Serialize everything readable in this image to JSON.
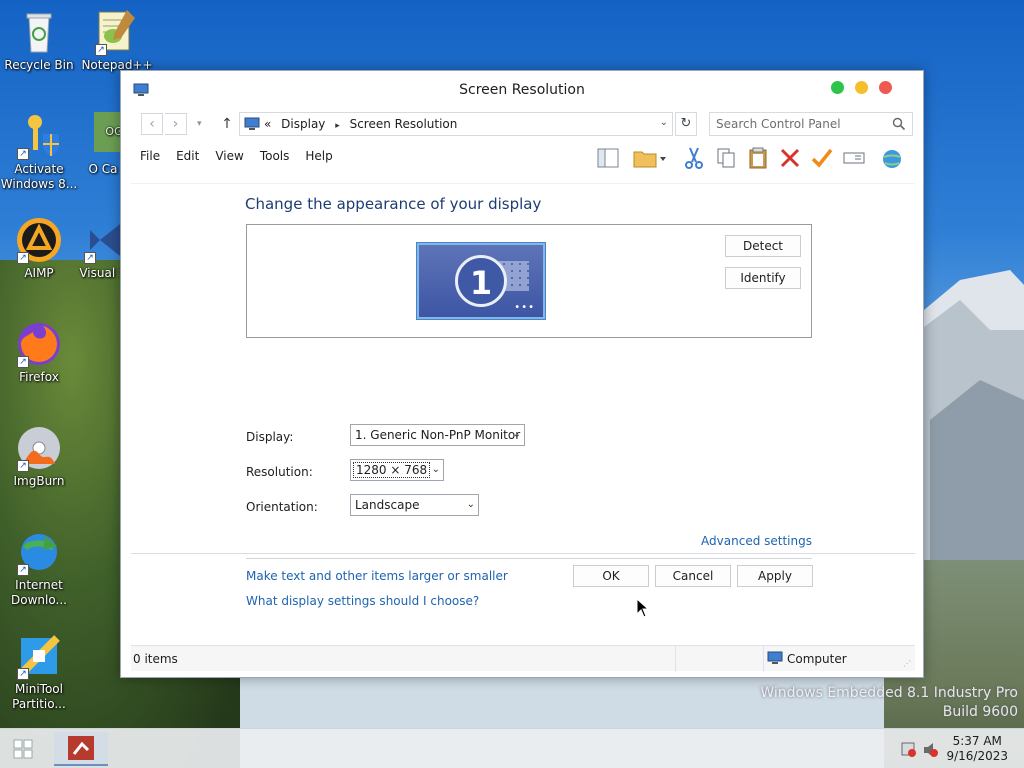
{
  "desktop": {
    "icons": [
      {
        "label": "Recycle Bin"
      },
      {
        "label": "Notepad++"
      },
      {
        "label": "Activate Windows 8..."
      },
      {
        "label": "O Ca"
      },
      {
        "label": "AIMP"
      },
      {
        "label": "Visual S"
      },
      {
        "label": "Firefox"
      },
      {
        "label": "ImgBurn"
      },
      {
        "label": "Internet Downlo..."
      },
      {
        "label": "MiniTool Partitio..."
      }
    ],
    "watermark_line1": "Windows Embedded 8.1 Industry Pro",
    "watermark_line2": "Build 9600"
  },
  "taskbar": {
    "time": "5:37 AM",
    "date": "9/16/2023"
  },
  "window": {
    "title": "Screen Resolution",
    "address": {
      "prefix": "«",
      "crumb1": "Display",
      "crumb2": "Screen Resolution"
    },
    "search_placeholder": "Search Control Panel",
    "menu": [
      "File",
      "Edit",
      "View",
      "Tools",
      "Help"
    ],
    "heading": "Change the appearance of your display",
    "monitor_number": "1",
    "buttons": {
      "detect": "Detect",
      "identify": "Identify",
      "ok": "OK",
      "cancel": "Cancel",
      "apply": "Apply"
    },
    "form": {
      "display_label": "Display:",
      "display_value": "1. Generic Non-PnP Monitor",
      "resolution_label": "Resolution:",
      "resolution_value": "1280 × 768",
      "orientation_label": "Orientation:",
      "orientation_value": "Landscape"
    },
    "links": {
      "advanced": "Advanced settings",
      "text_size": "Make text and other items larger or smaller",
      "help": "What display settings should I choose?"
    },
    "status": {
      "items": "0 items",
      "location": "Computer"
    }
  }
}
